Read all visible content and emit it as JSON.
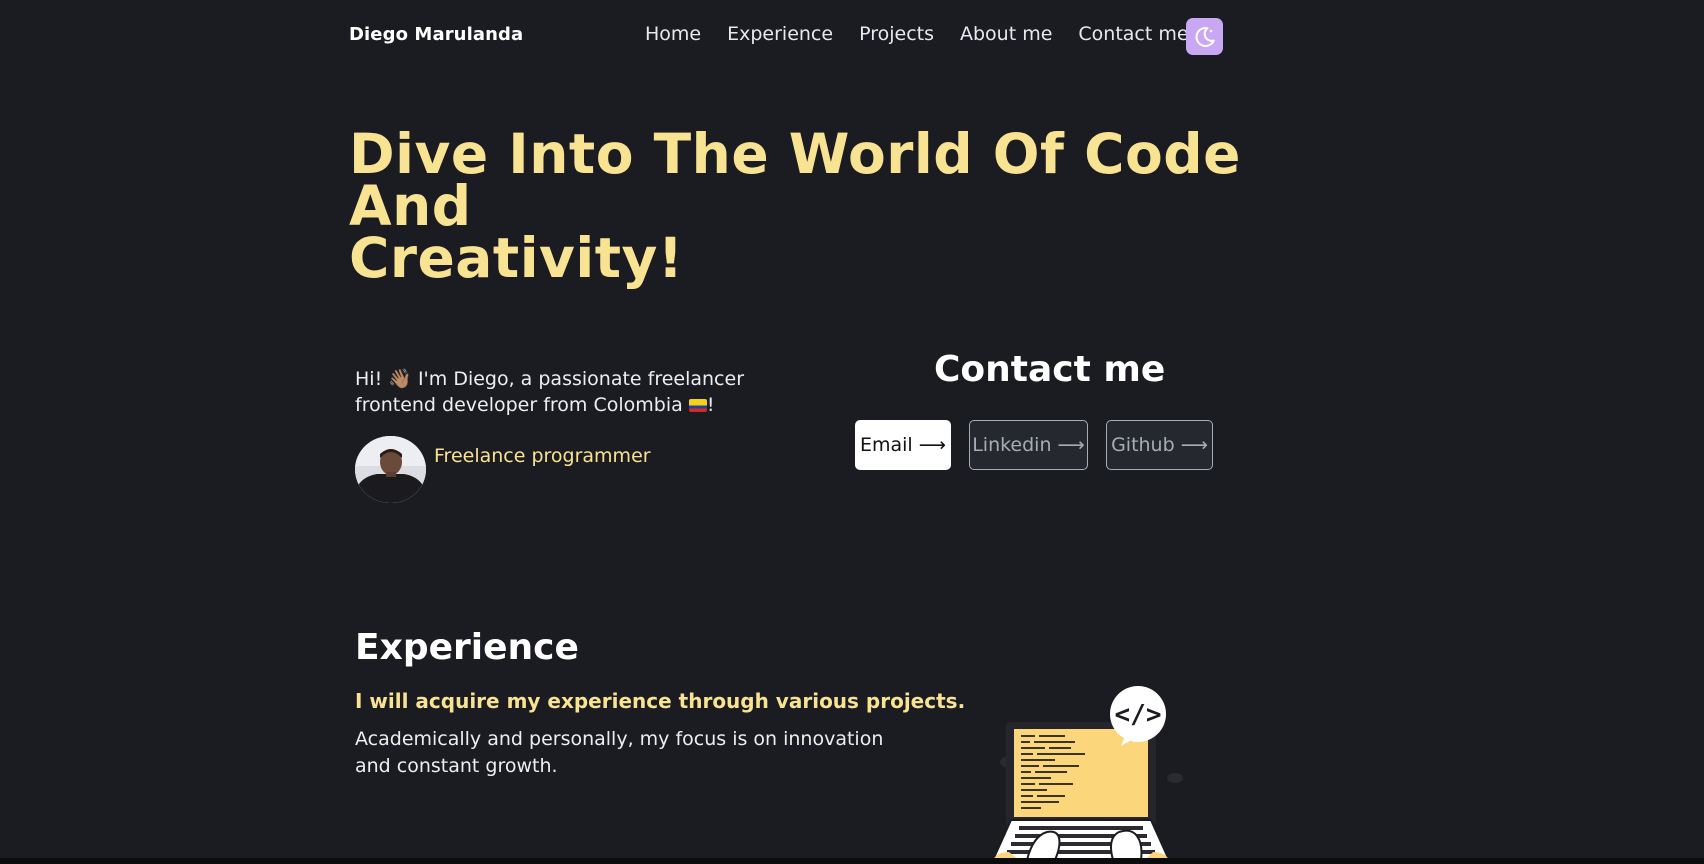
{
  "nav": {
    "brand": "Diego Marulanda",
    "links": [
      "Home",
      "Experience",
      "Projects",
      "About me",
      "Contact me"
    ],
    "theme_toggle_icon": "moon-icon"
  },
  "hero": {
    "title_line1": "Dive Into The World Of Code And",
    "title_line2": "Creativity!"
  },
  "intro": {
    "text_before_wave": "Hi! ",
    "wave_emoji": "👋🏽",
    "text_after_wave": " I'm Diego, a passionate freelancer frontend developer from Colombia ",
    "text_end": "!",
    "role": "Freelance programmer"
  },
  "contact": {
    "title": "Contact me",
    "email": "Email ⟶",
    "linkedin": "Linkedin ⟶",
    "github": "Github ⟶"
  },
  "experience": {
    "title": "Experience",
    "subtitle": "I will acquire my experience through various projects.",
    "description": "Academically and personally, my focus is on innovation and constant growth."
  },
  "colors": {
    "background": "#1b1b22",
    "accent_yellow": "#f8e392",
    "theme_toggle": "#c8a8f2"
  }
}
